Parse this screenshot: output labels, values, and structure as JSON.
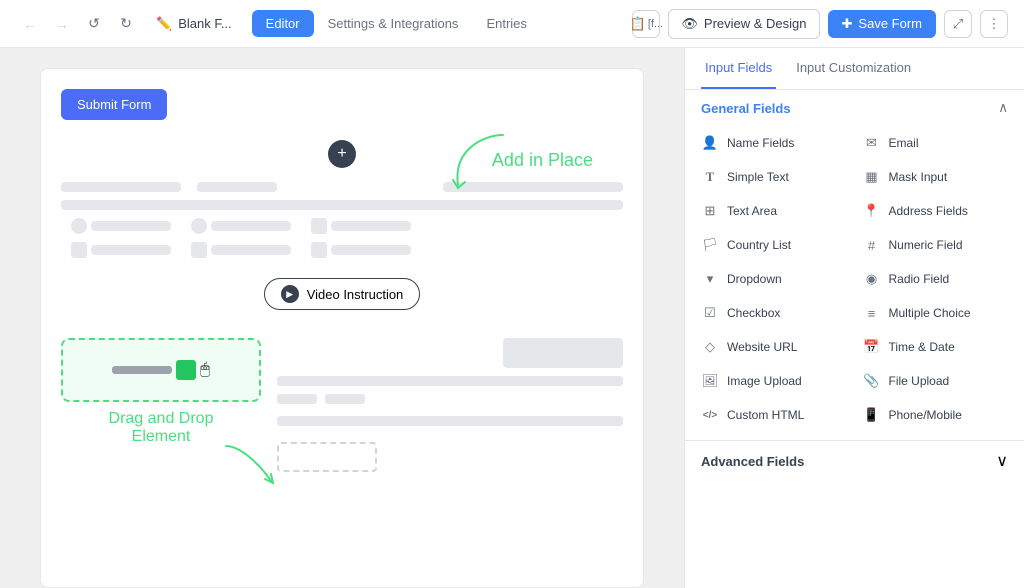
{
  "nav": {
    "back_label": "←",
    "forward_label": "→",
    "undo_label": "↺",
    "redo_label": "↻",
    "page_title": "Blank F...",
    "tabs": [
      {
        "id": "editor",
        "label": "Editor",
        "active": true
      },
      {
        "id": "settings",
        "label": "Settings & Integrations",
        "active": false
      },
      {
        "id": "entries",
        "label": "Entries",
        "active": false
      }
    ],
    "form_id_label": "[f...",
    "preview_label": "Preview & Design",
    "save_label": "Save Form",
    "expand_label": "⤢",
    "more_label": "⋮"
  },
  "editor": {
    "submit_btn_label": "Submit Form",
    "add_in_place_label": "Add in Place",
    "video_instruction_label": "Video Instruction",
    "drag_drop_label": "Drag and Drop\nElement"
  },
  "right_panel": {
    "tabs": [
      {
        "id": "input_fields",
        "label": "Input Fields",
        "active": true
      },
      {
        "id": "input_customization",
        "label": "Input Customization",
        "active": false
      }
    ],
    "general_fields": {
      "title": "General Fields",
      "items": [
        {
          "id": "name_fields",
          "label": "Name Fields",
          "icon": "👤"
        },
        {
          "id": "email",
          "label": "Email",
          "icon": "✉"
        },
        {
          "id": "simple_text",
          "label": "Simple Text",
          "icon": "T"
        },
        {
          "id": "mask_input",
          "label": "Mask Input",
          "icon": "▦"
        },
        {
          "id": "text_area",
          "label": "Text Area",
          "icon": "⊞"
        },
        {
          "id": "address_fields",
          "label": "Address Fields",
          "icon": "📍"
        },
        {
          "id": "country_list",
          "label": "Country List",
          "icon": "🏳"
        },
        {
          "id": "numeric_field",
          "label": "Numeric Field",
          "icon": "#"
        },
        {
          "id": "dropdown",
          "label": "Dropdown",
          "icon": "▾"
        },
        {
          "id": "radio_field",
          "label": "Radio Field",
          "icon": "◉"
        },
        {
          "id": "checkbox",
          "label": "Checkbox",
          "icon": "☑"
        },
        {
          "id": "multiple_choice",
          "label": "Multiple Choice",
          "icon": "≡"
        },
        {
          "id": "website_url",
          "label": "Website URL",
          "icon": "◇"
        },
        {
          "id": "time_date",
          "label": "Time & Date",
          "icon": "📅"
        },
        {
          "id": "image_upload",
          "label": "Image Upload",
          "icon": "🖼"
        },
        {
          "id": "file_upload",
          "label": "File Upload",
          "icon": "📎"
        },
        {
          "id": "custom_html",
          "label": "Custom HTML",
          "icon": "</>"
        },
        {
          "id": "phone_mobile",
          "label": "Phone/Mobile",
          "icon": "📱"
        }
      ]
    },
    "advanced_fields": {
      "title": "Advanced Fields"
    }
  }
}
